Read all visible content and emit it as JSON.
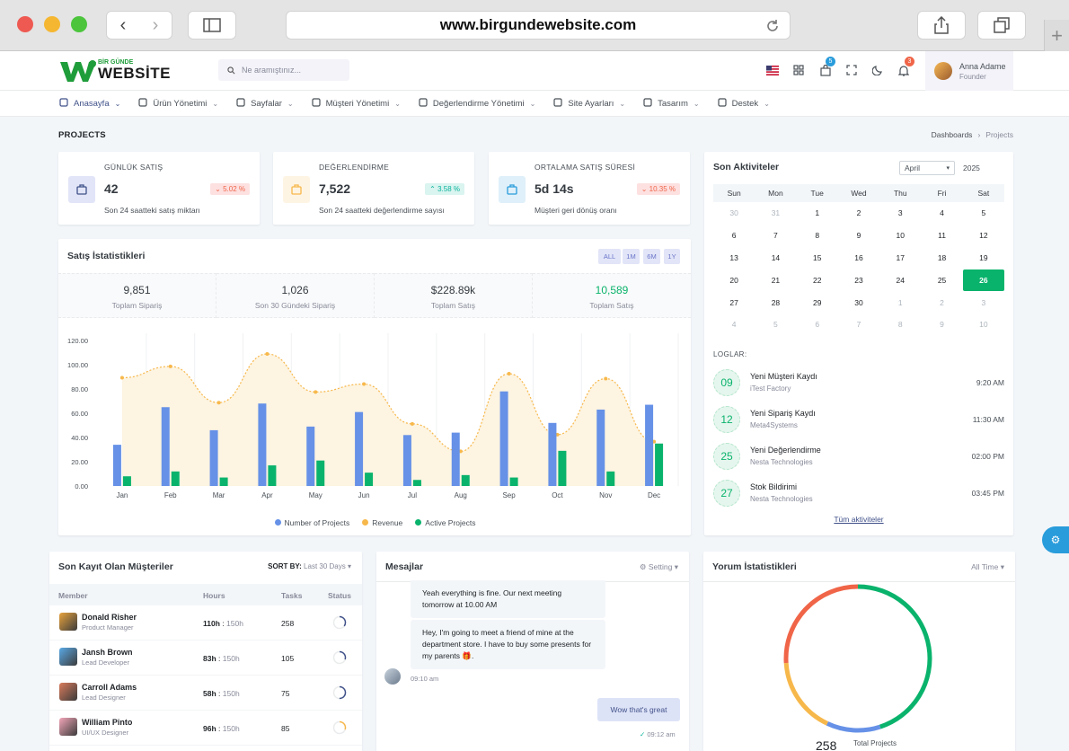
{
  "browser": {
    "url": "www.birgundewebsite.com"
  },
  "header": {
    "logo_small": "BİR GÜNDE",
    "logo_big": "WEBSİTE",
    "search_placeholder": "Ne aramıştınız...",
    "cart_badge": "5",
    "notif_badge": "3",
    "user_name": "Anna Adame",
    "user_role": "Founder"
  },
  "menu": [
    {
      "label": "Anasayfa",
      "icon": "grid-icon"
    },
    {
      "label": "Ürün Yönetimi",
      "icon": "layers-icon"
    },
    {
      "label": "Sayfalar",
      "icon": "layout-icon"
    },
    {
      "label": "Müşteri Yönetimi",
      "icon": "user-circle-icon"
    },
    {
      "label": "Değerlendirme Yönetimi",
      "icon": "file-icon"
    },
    {
      "label": "Site Ayarları",
      "icon": "bell-icon"
    },
    {
      "label": "Tasarım",
      "icon": "palette-icon"
    },
    {
      "label": "Destek",
      "icon": "briefcase-icon"
    }
  ],
  "page": {
    "title": "PROJECTS",
    "crumb1": "Dashboards",
    "crumb_sep": "›",
    "crumb2": "Projects"
  },
  "stats": [
    {
      "label": "GÜNLÜK SATIŞ",
      "value": "42",
      "change": "5.02 %",
      "dir": "down",
      "sub": "Son 24 saatteki satış miktarı",
      "icon": "briefcase-icon",
      "color": "#405189",
      "bg": "#e2e5f8"
    },
    {
      "label": "DEĞERLENDİRME",
      "value": "7,522",
      "change": "3.58 %",
      "dir": "up",
      "sub": "Son 24 saatteki değerlendirme sayısı",
      "icon": "award-icon",
      "color": "#f7b84b",
      "bg": "#fef4e4"
    },
    {
      "label": "ORTALAMA SATIŞ SÜRESİ",
      "value": "5d 14s",
      "change": "10.35 %",
      "dir": "down",
      "sub": "Müşteri geri dönüş oranı",
      "icon": "clock-icon",
      "color": "#299cdb",
      "bg": "#dff0fa"
    }
  ],
  "sales": {
    "title": "Satış İstatistikleri",
    "filters": [
      "ALL",
      "1M",
      "6M",
      "1Y"
    ],
    "summary": [
      {
        "value": "9,851",
        "label": "Toplam Sipariş"
      },
      {
        "value": "1,026",
        "label": "Son 30 Gündeki Sipariş"
      },
      {
        "value": "$228.89k",
        "label": "Toplam Satış"
      },
      {
        "value": "10,589",
        "label": "Toplam Satış"
      }
    ]
  },
  "chart_data": {
    "type": "bar",
    "categories": [
      "Jan",
      "Feb",
      "Mar",
      "Apr",
      "May",
      "Jun",
      "Jul",
      "Aug",
      "Sep",
      "Oct",
      "Nov",
      "Dec"
    ],
    "series": [
      {
        "name": "Number of Projects",
        "type": "bar",
        "color": "#6691e7",
        "values": [
          34,
          65,
          46,
          68,
          49,
          61,
          42,
          44,
          78,
          52,
          63,
          67
        ]
      },
      {
        "name": "Revenue",
        "type": "area",
        "color": "#f7b84b",
        "values": [
          89.25,
          98.58,
          68.74,
          108.87,
          77.54,
          84.03,
          51.24,
          28.57,
          92.57,
          42.36,
          88.51,
          36.57
        ]
      },
      {
        "name": "Active Projects",
        "type": "bar",
        "color": "#0ab36c",
        "values": [
          8,
          12,
          7,
          17,
          21,
          11,
          5,
          9,
          7,
          29,
          12,
          35
        ]
      }
    ],
    "yticks": [
      "0.00",
      "20.00",
      "40.00",
      "60.00",
      "80.00",
      "100.00",
      "120.00"
    ],
    "ylim": [
      0,
      120
    ]
  },
  "activity": {
    "title": "Son Aktiviteler",
    "month": "April",
    "year": "2025",
    "weekdays": [
      "Sun",
      "Mon",
      "Tue",
      "Wed",
      "Thu",
      "Fri",
      "Sat"
    ],
    "weeks": [
      [
        "30",
        "31",
        "1",
        "2",
        "3",
        "4",
        "5"
      ],
      [
        "6",
        "7",
        "8",
        "9",
        "10",
        "11",
        "12"
      ],
      [
        "13",
        "14",
        "15",
        "16",
        "17",
        "18",
        "19"
      ],
      [
        "20",
        "21",
        "22",
        "23",
        "24",
        "25",
        "26"
      ],
      [
        "27",
        "28",
        "29",
        "30",
        "1",
        "2",
        "3"
      ],
      [
        "4",
        "5",
        "6",
        "7",
        "8",
        "9",
        "10"
      ]
    ],
    "logs_label": "LOGLAR:",
    "logs": [
      {
        "day": "09",
        "title": "Yeni Müşteri Kaydı",
        "sub": "iTest Factory",
        "time": "9:20 AM"
      },
      {
        "day": "12",
        "title": "Yeni Sipariş Kaydı",
        "sub": "Meta4Systems",
        "time": "11:30 AM"
      },
      {
        "day": "25",
        "title": "Yeni Değerlendirme",
        "sub": "Nesta Technologies",
        "time": "02:00 PM"
      },
      {
        "day": "27",
        "title": "Stok Bildirimi",
        "sub": "Nesta Technologies",
        "time": "03:45 PM"
      }
    ],
    "all_link": "Tüm aktiviteler"
  },
  "customers": {
    "title": "Son Kayıt Olan Müşteriler",
    "sort_label": "SORT BY:",
    "sort_value": "Last 30 Days",
    "columns": [
      "Member",
      "Hours",
      "Tasks",
      "Status"
    ],
    "rows": [
      {
        "name": "Donald Risher",
        "role": "Product Manager",
        "hours": "110h",
        "total": "150h",
        "tasks": "258",
        "status_color": "#405189",
        "status_pct": 0.35
      },
      {
        "name": "Jansh Brown",
        "role": "Lead Developer",
        "hours": "83h",
        "total": "150h",
        "tasks": "105",
        "status_color": "#405189",
        "status_pct": 0.3
      },
      {
        "name": "Carroll Adams",
        "role": "Lead Designer",
        "hours": "58h",
        "total": "150h",
        "tasks": "75",
        "status_color": "#405189",
        "status_pct": 0.5
      },
      {
        "name": "William Pinto",
        "role": "UI/UX Designer",
        "hours": "96h",
        "total": "150h",
        "tasks": "85",
        "status_color": "#f7b84b",
        "status_pct": 0.3
      }
    ]
  },
  "messages": {
    "title": "Mesajlar",
    "setting": "Setting",
    "msg1": "Yeah everything is fine. Our next meeting tomorrow at 10.00 AM",
    "msg2": "Hey, I'm going to meet a friend of mine at the department store. I have to buy some presents for my parents 🎁.",
    "msg2_time": "09:10 am",
    "reply": "Wow that's great",
    "reply_time": "09:12 am"
  },
  "reviews": {
    "title": "Yorum İstatistikleri",
    "filter": "All Time",
    "total_value": "258",
    "total_label": "Total Projects",
    "donut": [
      {
        "color": "#0ab36c",
        "value": 45
      },
      {
        "color": "#6691e7",
        "value": 12
      },
      {
        "color": "#f7b84b",
        "value": 17
      },
      {
        "color": "#f06548",
        "value": 26
      }
    ]
  }
}
